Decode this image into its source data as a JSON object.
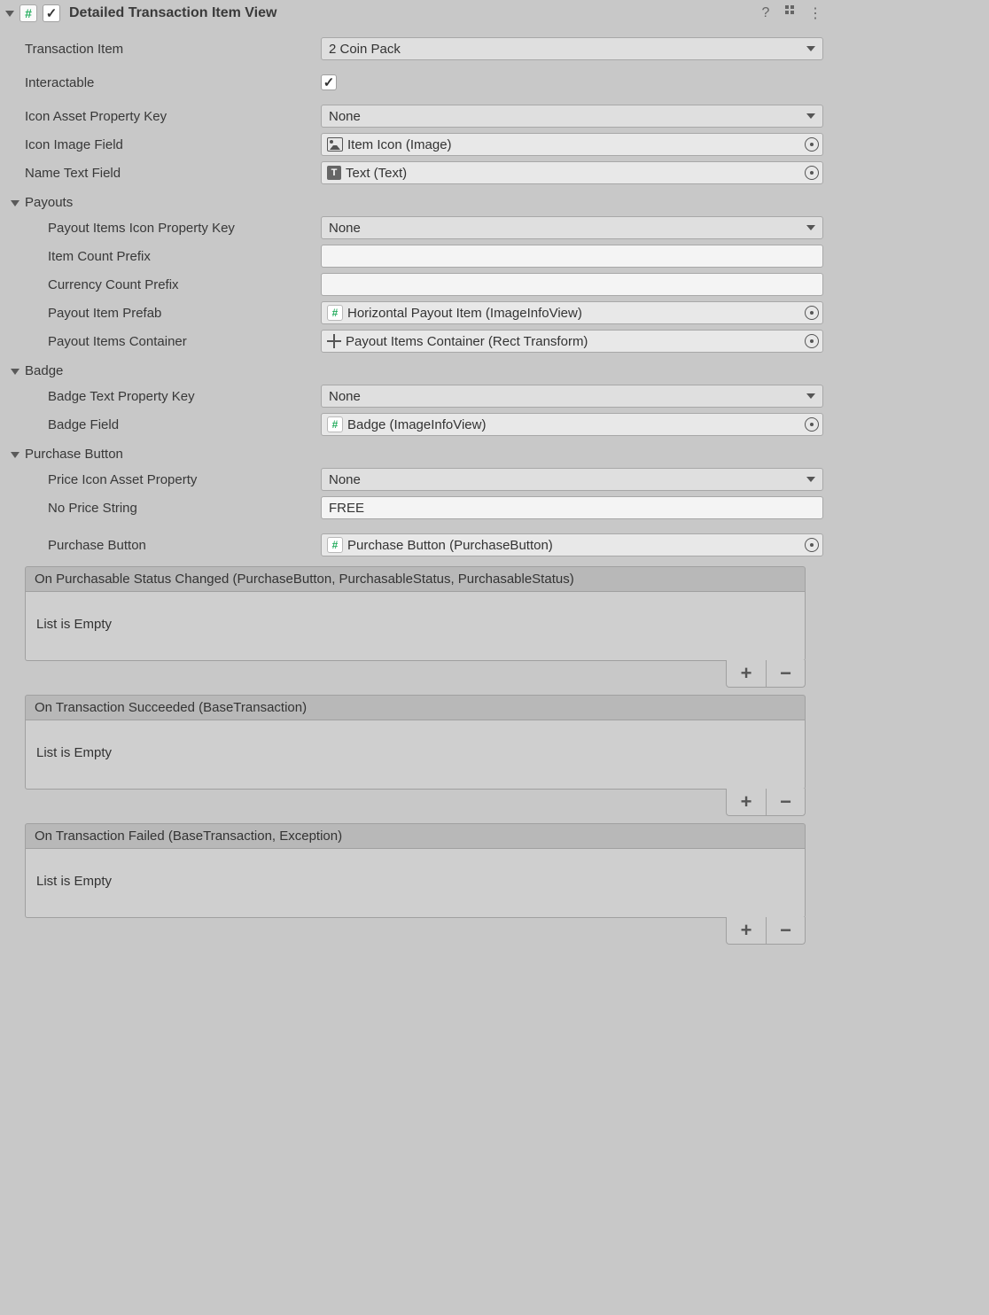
{
  "header": {
    "title": "Detailed Transaction Item View"
  },
  "fields": {
    "transactionItem": {
      "label": "Transaction Item",
      "value": "2 Coin Pack"
    },
    "interactableLabel": "Interactable",
    "iconAssetKey": {
      "label": "Icon Asset Property Key",
      "value": "None"
    },
    "iconImageField": {
      "label": "Icon Image Field",
      "value": "Item Icon (Image)"
    },
    "nameTextField": {
      "label": "Name Text Field",
      "value": "Text (Text)"
    }
  },
  "payouts": {
    "sectionLabel": "Payouts",
    "iconKey": {
      "label": "Payout Items Icon Property Key",
      "value": "None"
    },
    "itemCountPrefix": {
      "label": "Item Count Prefix",
      "value": ""
    },
    "currencyCountPrefix": {
      "label": "Currency Count Prefix",
      "value": ""
    },
    "itemPrefab": {
      "label": "Payout Item Prefab",
      "value": "Horizontal Payout Item (ImageInfoView)"
    },
    "itemsContainer": {
      "label": "Payout Items Container",
      "value": "Payout Items Container (Rect Transform)"
    }
  },
  "badge": {
    "sectionLabel": "Badge",
    "textKey": {
      "label": "Badge Text Property Key",
      "value": "None"
    },
    "field": {
      "label": "Badge Field",
      "value": "Badge (ImageInfoView)"
    }
  },
  "purchase": {
    "sectionLabel": "Purchase Button",
    "priceIcon": {
      "label": "Price Icon Asset Property",
      "value": "None"
    },
    "noPrice": {
      "label": "No Price String",
      "value": "FREE"
    },
    "button": {
      "label": "Purchase Button",
      "value": "Purchase Button (PurchaseButton)"
    }
  },
  "events": {
    "emptyText": "List is Empty",
    "onPurchasable": "On Purchasable Status Changed (PurchaseButton, PurchasableStatus, PurchasableStatus)",
    "onSucceeded": "On Transaction Succeeded (BaseTransaction)",
    "onFailed": "On Transaction Failed (BaseTransaction, Exception)"
  }
}
